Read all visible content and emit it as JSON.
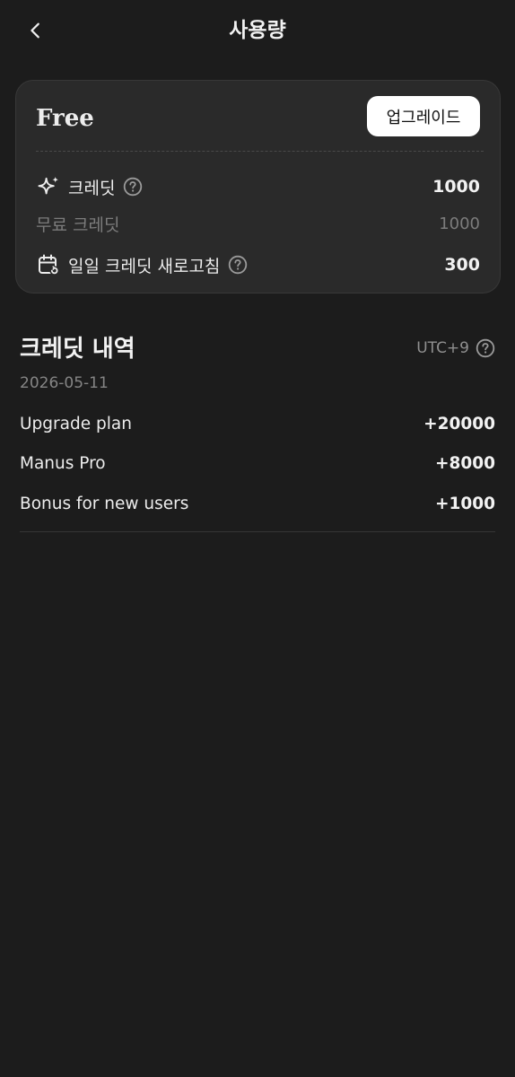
{
  "header": {
    "title": "사용량",
    "back_icon": "chevron-left-icon"
  },
  "plan": {
    "name": "Free",
    "upgrade_label": "업그레이드",
    "credits_label": "크레딧",
    "credits_value": "1000",
    "free_credits_label": "무료 크레딧",
    "free_credits_value": "1000",
    "daily_refresh_label": "일일 크레딧 새로고침",
    "daily_refresh_value": "300"
  },
  "history": {
    "title": "크레딧 내역",
    "timezone": "UTC+9",
    "date": "2026-05-11",
    "items": [
      {
        "label": "Upgrade plan",
        "amount": "+20000"
      },
      {
        "label": "Manus Pro",
        "amount": "+8000"
      },
      {
        "label": "Bonus for new users",
        "amount": "+1000"
      }
    ]
  },
  "colors": {
    "background": "#1c1c1c",
    "card": "#2a2a2a",
    "muted_text": "#7c7c7c"
  }
}
